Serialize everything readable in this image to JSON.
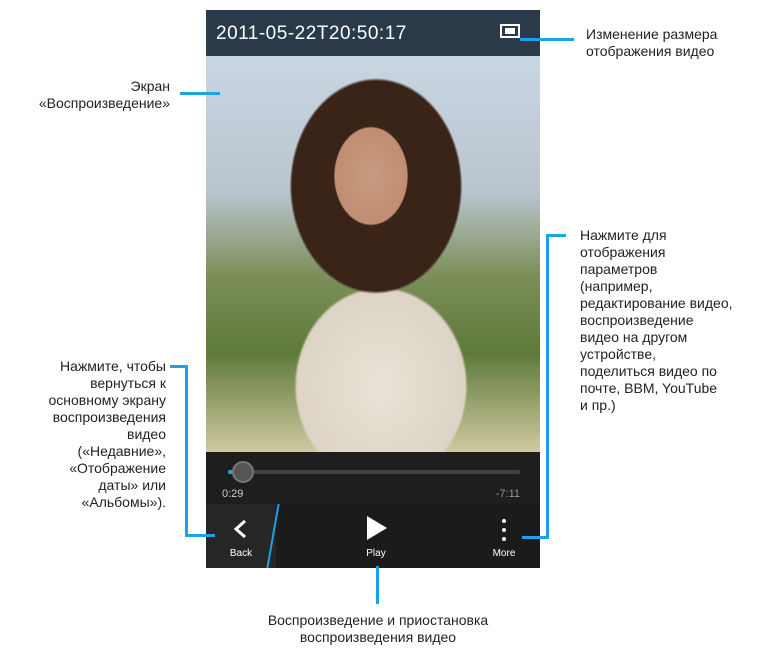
{
  "video": {
    "timestamp": "2011-05-22T20:50:17",
    "elapsed": "0:29",
    "remaining": "-7:11",
    "progress_fraction": 0.05
  },
  "actions": {
    "back_label": "Back",
    "play_label": "Play",
    "more_label": "More"
  },
  "icons": {
    "resize": "resize-screen-icon",
    "back": "chevron-left-icon",
    "play": "play-icon",
    "more": "overflow-menu-icon"
  },
  "callouts": {
    "resize": "Изменение размера\nотображения видео",
    "screen": "Экран\n«Воспроизведение»",
    "back": "Нажмите, чтобы\nвернуться к\nосновному экрану\nвоспроизведения\nвидео\n(«Недавние»,\n«Отображение\nдаты» или\n«Альбомы»).",
    "more": "Нажмите для\nотображения\nпараметров\n(например,\nредактирование видео,\nвоспроизведение\nвидео на другом\nустройстве,\nподелиться видео по\nпочте, BBM, YouTube\nи пр.)",
    "play": "Воспроизведение и приостановка\nвоспроизведения видео"
  },
  "colors": {
    "accent": "#1aa3e8",
    "topbar": "#2a3a48",
    "actionbar": "#1b1b1b"
  }
}
